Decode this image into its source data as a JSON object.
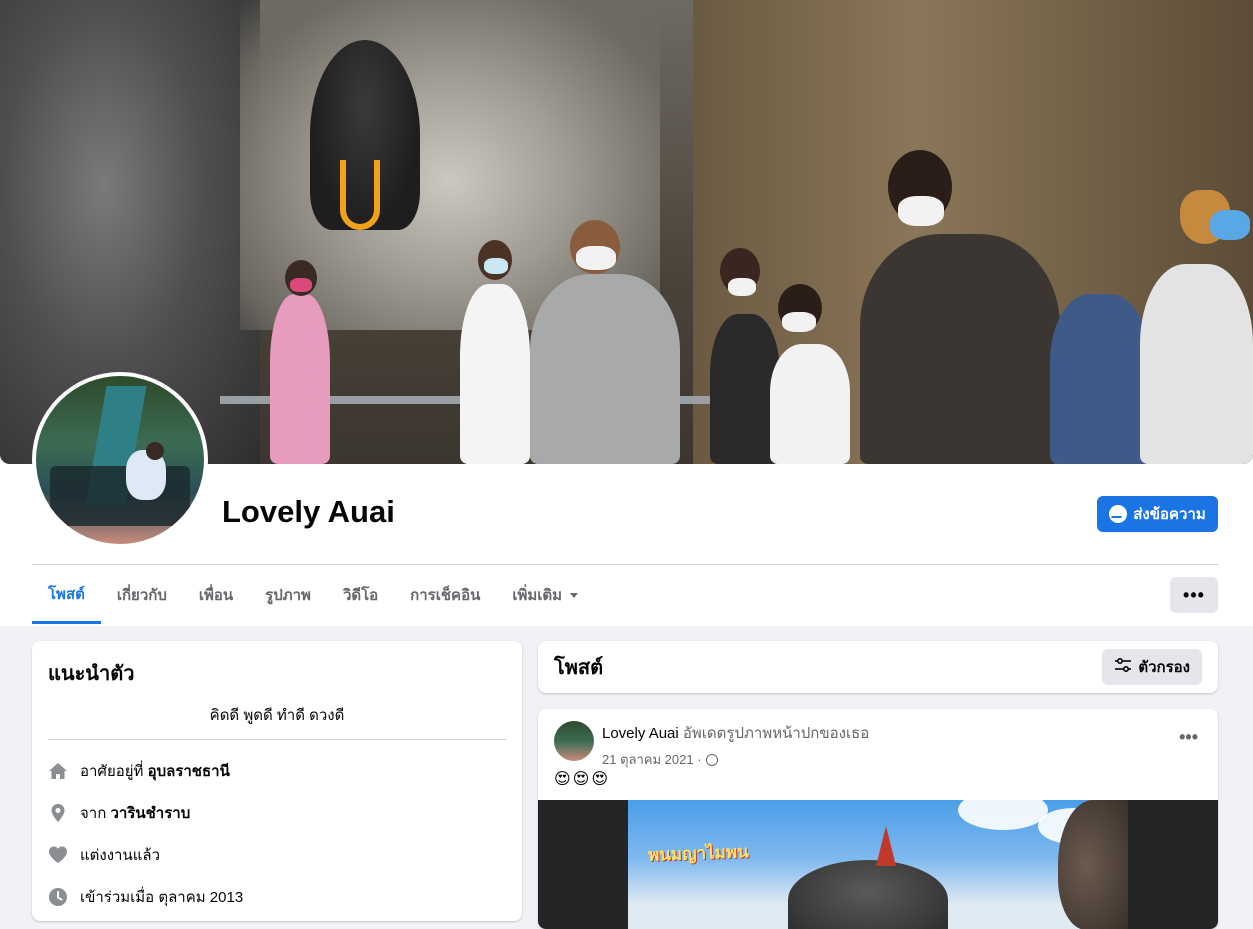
{
  "profile": {
    "name": "Lovely Auai",
    "message_button": "ส่งข้อความ"
  },
  "tabs": [
    {
      "label": "โพสต์",
      "active": true
    },
    {
      "label": "เกี่ยวกับ"
    },
    {
      "label": "เพื่อน"
    },
    {
      "label": "รูปภาพ"
    },
    {
      "label": "วิดีโอ"
    },
    {
      "label": "การเช็คอิน"
    },
    {
      "label": "เพิ่มเติม"
    }
  ],
  "more_button": "•••",
  "intro": {
    "title": "แนะนำตัว",
    "bio": "คิดดี พูดดี ทำดี ดวงดี",
    "lives_prefix": "อาศัยอยู่ที่",
    "lives_value": "อุบลราชธานี",
    "from_prefix": "จาก",
    "from_value": "วารินชำราบ",
    "relationship": "แต่งงานแล้ว",
    "joined": "เข้าร่วมเมื่อ ตุลาคม 2013"
  },
  "posts_section": {
    "title": "โพสต์",
    "filter_label": "ตัวกรอง"
  },
  "post": {
    "author": "Lovely Auai",
    "action": "อัพเดตรูปภาพหน้าปกของเธอ",
    "date": "21 ตุลาคม 2021 ·",
    "emojis": "😍😍😍",
    "dots": "•••",
    "image_sign_text": "พนมญาไมพน"
  },
  "colors": {
    "accent": "#1b74e4",
    "background": "#f0f2f5",
    "secondary_text": "#65676b"
  }
}
